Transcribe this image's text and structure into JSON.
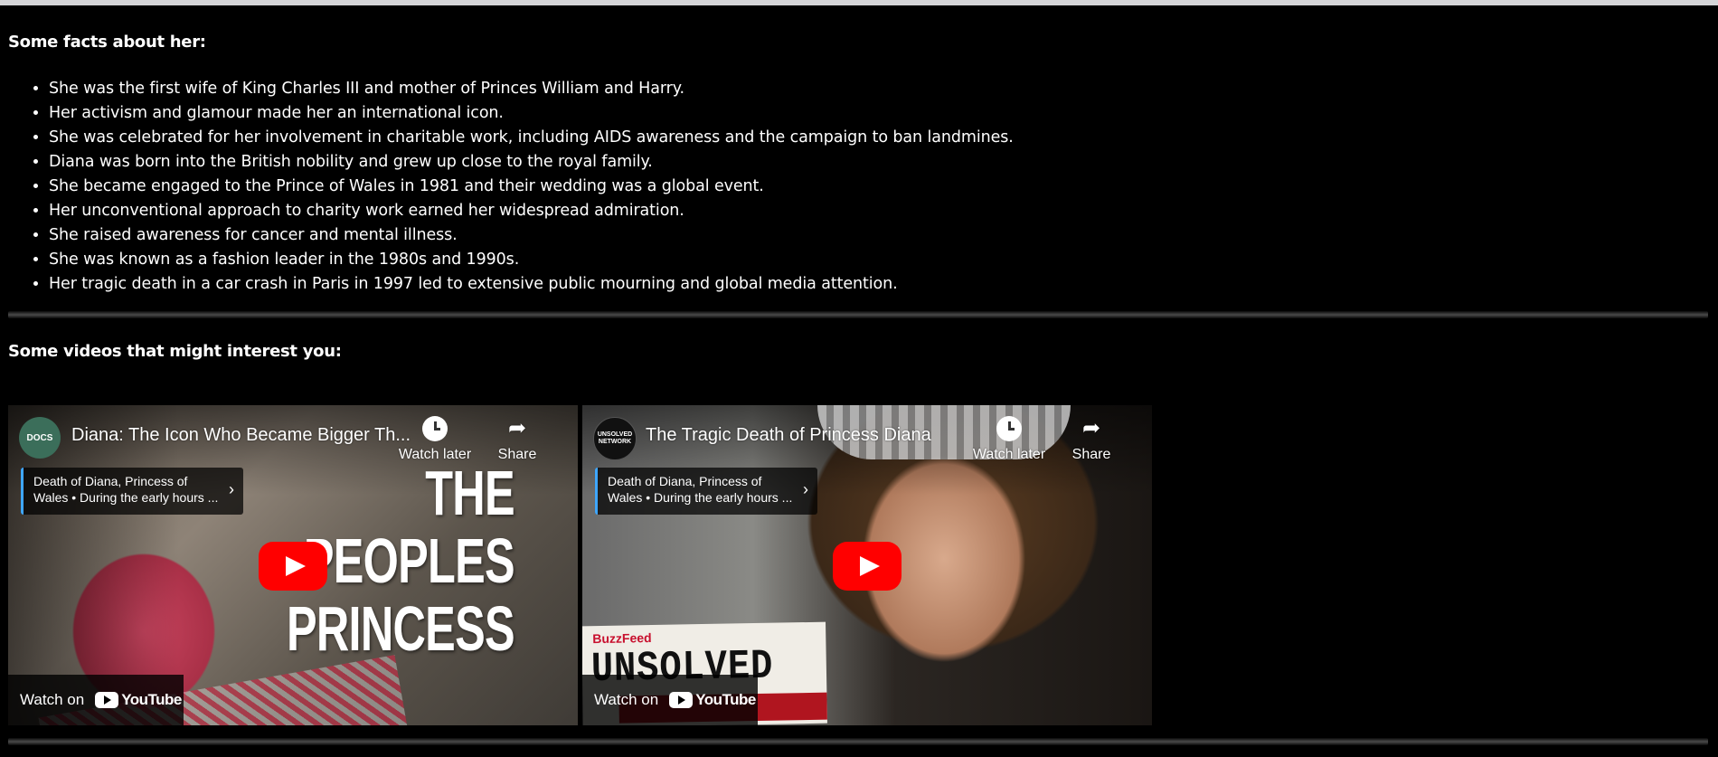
{
  "facts": {
    "heading": "Some facts about her:",
    "items": [
      "She was the first wife of King Charles III and mother of Princes William and Harry.",
      "Her activism and glamour made her an international icon.",
      "She was celebrated for her involvement in charitable work, including AIDS awareness and the campaign to ban landmines.",
      "Diana was born into the British nobility and grew up close to the royal family.",
      "She became engaged to the Prince of Wales in 1981 and their wedding was a global event.",
      "Her unconventional approach to charity work earned her widespread admiration.",
      "She raised awareness for cancer and mental illness.",
      "She was known as a fashion leader in the 1980s and 1990s.",
      "Her tragic death in a car crash in Paris in 1997 led to extensive public mourning and global media attention."
    ]
  },
  "videos": {
    "heading": "Some videos that might interest you:",
    "items": [
      {
        "title": "Diana: The Icon Who Became Bigger Th...",
        "channel_avatar": "DOCS",
        "watch_later_label": "Watch later",
        "share_label": "Share",
        "chapter_line1": "Death of Diana, Princess of",
        "chapter_line2": "Wales • During the early hours ...",
        "thumbnail_text": [
          "THE",
          "PEOPLES",
          "PRINCESS"
        ],
        "watch_on_label": "Watch on",
        "youtube_label": "YouTube"
      },
      {
        "title": "The Tragic Death of Princess Diana",
        "channel_avatar": "UNSOLVED NETWORK",
        "watch_later_label": "Watch later",
        "share_label": "Share",
        "chapter_line1": "Death of Diana, Princess of",
        "chapter_line2": "Wales • During the early hours ...",
        "thumbnail_brand": "BuzzFeed",
        "thumbnail_word": "UNSOLVED",
        "watch_on_label": "Watch on",
        "youtube_label": "YouTube"
      }
    ]
  },
  "colors": {
    "background": "#000000",
    "text": "#ffffff",
    "youtube_red": "#ff0000",
    "chapter_accent": "#3ea6ff"
  }
}
